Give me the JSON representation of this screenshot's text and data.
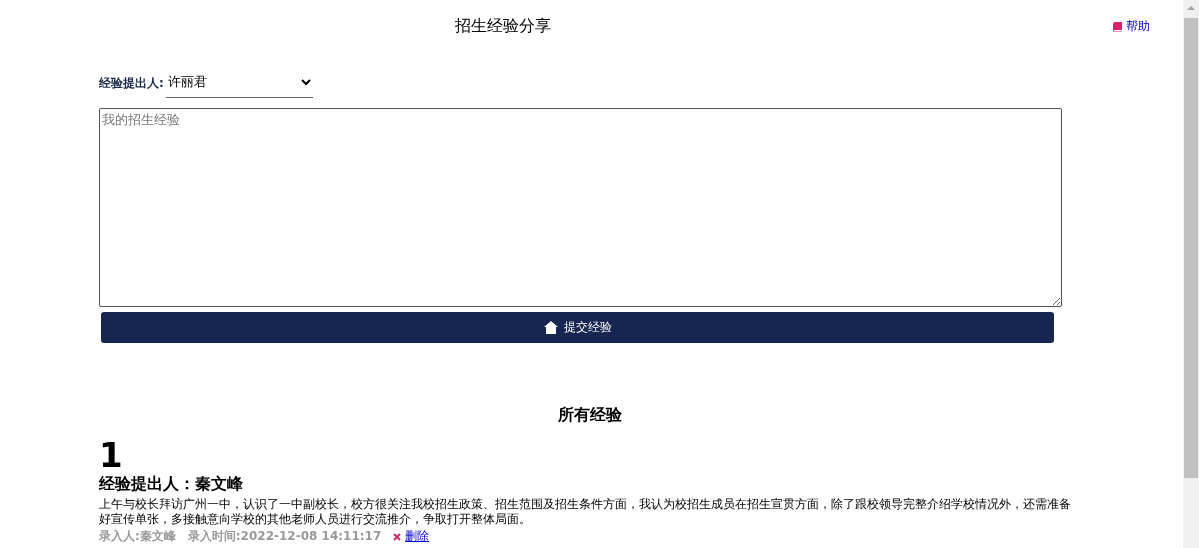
{
  "header": {
    "title": "招生经验分享",
    "help_link": "帮助"
  },
  "form": {
    "proposer_label": "经验提出人:",
    "proposer_value": "许丽君",
    "textarea_placeholder": "我的招生经验",
    "submit_button": "提交经验"
  },
  "list": {
    "title": "所有经验",
    "entries": [
      {
        "number": "1",
        "heading": "经验提出人：秦文峰",
        "body": "上午与校长拜访广州一中，认识了一中副校长，校方很关注我校招生政策、招生范围及招生条件方面，我认为校招生成员在招生宣贯方面，除了跟校领导完整介绍学校情况外，还需准备好宣传单张，多接触意向学校的其他老师人员进行交流推介，争取打开整体局面。",
        "recorder": "录入人:秦文峰",
        "time": "录入时间:2022-12-08 14:11:17",
        "delete_link": "删除"
      }
    ]
  }
}
